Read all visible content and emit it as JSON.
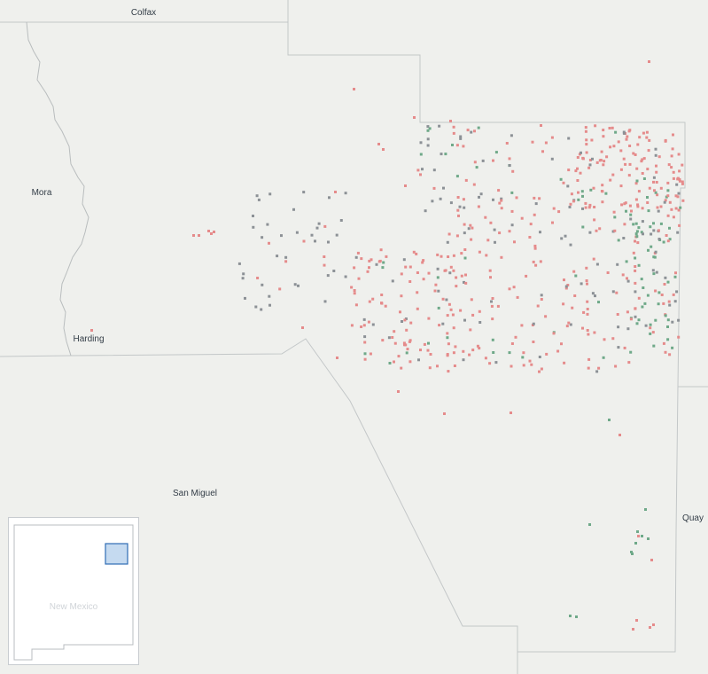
{
  "colors": {
    "background": "#eff0ed",
    "boundary": "#c3c7c8",
    "river": "#b9bdbe",
    "dot_red": "#e58b8b",
    "dot_green": "#6fa989",
    "dot_gray": "#8c9196",
    "inset_highlight_fill": "#c5daf0",
    "inset_highlight_stroke": "#2f6cb3"
  },
  "map": {
    "counties": [
      "Colfax",
      "Mora",
      "Harding",
      "San Miguel",
      "Quay"
    ]
  },
  "legend_categories": [
    "red",
    "green",
    "gray"
  ],
  "inset": {
    "state_label": "New Mexico"
  }
}
